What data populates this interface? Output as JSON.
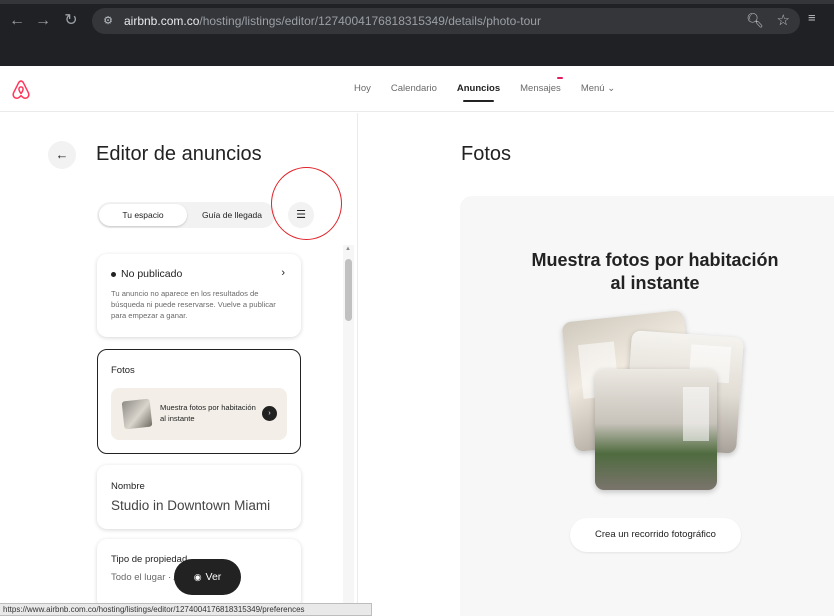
{
  "browser": {
    "url_domain": "airbnb.com.co",
    "url_path": "/hosting/listings/editor/1274004176818315349/details/photo-tour",
    "status_url": "https://www.airbnb.com.co/hosting/listings/editor/1274004176818315349/preferences"
  },
  "header": {
    "nav": [
      "Hoy",
      "Calendario",
      "Anuncios",
      "Mensajes",
      "Menú"
    ],
    "active_nav": "Anuncios",
    "messages_badge": "",
    "menu_chevron": "⌄"
  },
  "editor": {
    "title": "Editor de anuncios",
    "tabs": [
      "Tu espacio",
      "Guía de llegada"
    ],
    "status_card": {
      "title": "No publicado",
      "description": "Tu anuncio no aparece en los resultados de búsqueda ni puede reservarse. Vuelve a publicar para empezar a ganar."
    },
    "photos_card": {
      "label": "Fotos",
      "promo_text": "Muestra fotos por habitación al instante"
    },
    "name_card": {
      "label": "Nombre",
      "value": "Studio in Downtown Miami"
    },
    "property_card": {
      "label": "Tipo de propiedad",
      "value": "Todo el lugar · Apartamentos"
    },
    "view_button": "Ver"
  },
  "main": {
    "title": "Fotos",
    "headline": "Muestra fotos por habitación al instante",
    "cta": "Crea un recorrido fotográfico"
  },
  "colors": {
    "brand": "#ff385c",
    "annotation_circle": "#e0242b",
    "badge": "#e31c5f"
  }
}
